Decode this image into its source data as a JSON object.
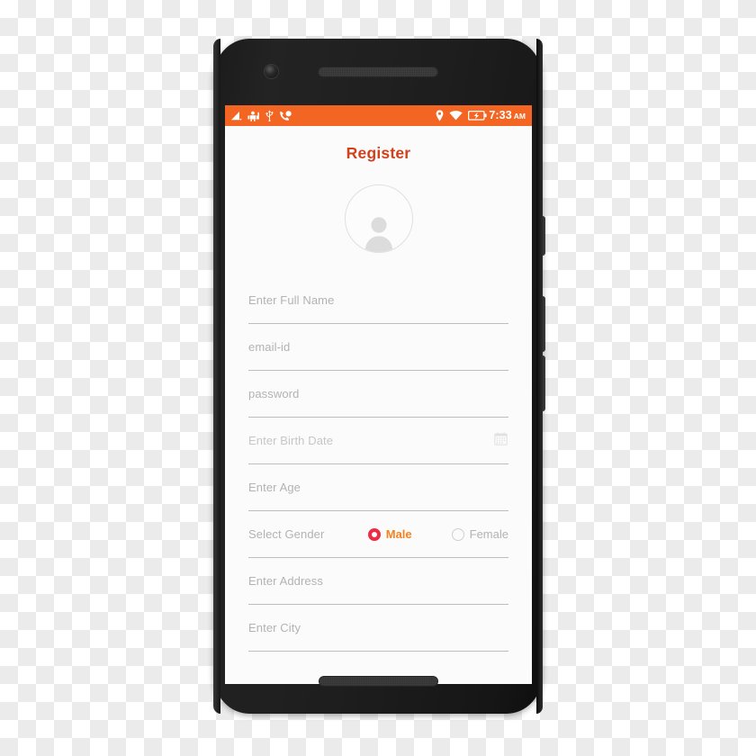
{
  "device": {
    "name": "android-smartphone",
    "camera": "front-camera",
    "earpiece": "earpiece-speaker",
    "bottom_speaker": "bottom-speaker",
    "buttons": [
      "power-button",
      "volume-up-button",
      "volume-down-button"
    ]
  },
  "status_bar": {
    "background": "#f26522",
    "left_icons": [
      "signal-icon",
      "android-robot-icon",
      "usb-icon",
      "call-icon"
    ],
    "right_icons": [
      "location-pin-icon",
      "wifi-icon",
      "battery-charging-icon"
    ],
    "time": "7:33",
    "meridiem": "AM"
  },
  "screen": {
    "title": "Register",
    "title_color": "#d2401c",
    "avatar": {
      "name": "profile-avatar-placeholder",
      "icon": "person-icon"
    },
    "fields": [
      {
        "name": "full-name",
        "placeholder": "Enter Full Name",
        "trailing_icon": null
      },
      {
        "name": "email",
        "placeholder": "email-id",
        "trailing_icon": null
      },
      {
        "name": "password",
        "placeholder": "password",
        "trailing_icon": null
      },
      {
        "name": "birth-date",
        "placeholder": "Enter Birth Date",
        "trailing_icon": "calendar-icon"
      },
      {
        "name": "age",
        "placeholder": "Enter Age",
        "trailing_icon": null
      },
      {
        "name": "address",
        "placeholder": "Enter Address",
        "trailing_icon": null
      },
      {
        "name": "city",
        "placeholder": "Enter City",
        "trailing_icon": null
      }
    ],
    "gender": {
      "label": "Select Gender",
      "options": [
        {
          "label": "Male",
          "selected": true,
          "ring_color": "#ef2b45",
          "label_color": "#f58220"
        },
        {
          "label": "Female",
          "selected": false,
          "ring_color": "#cfcfcf",
          "label_color": "#b3b3b3"
        }
      ]
    }
  }
}
